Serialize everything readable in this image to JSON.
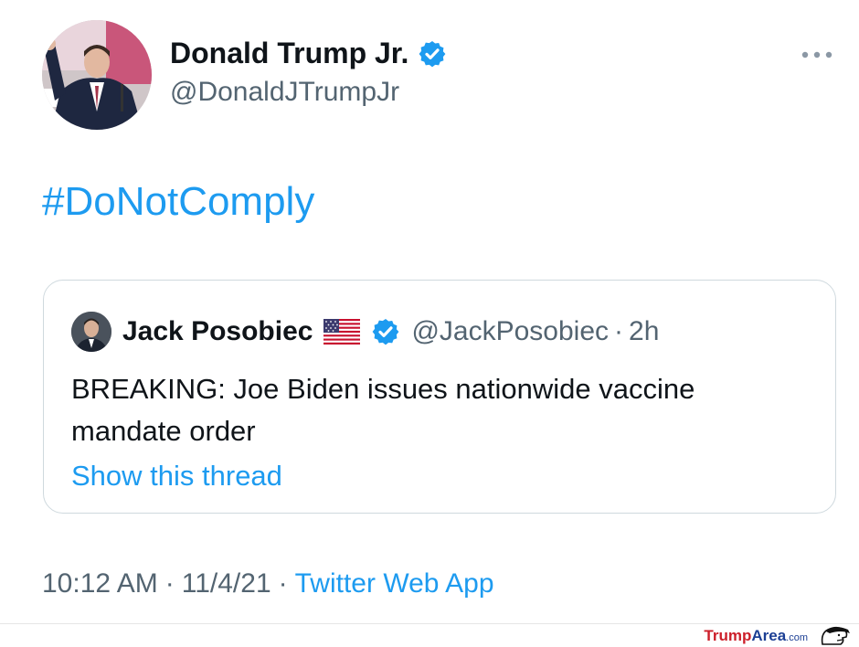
{
  "tweet": {
    "author": {
      "name": "Donald Trump Jr.",
      "handle": "@DonaldJTrumpJr",
      "verified": true
    },
    "text": "#DoNotComply",
    "quoted_tweet": {
      "author_name": "Jack Posobiec",
      "author_handle": "@JackPosobiec",
      "separator": "·",
      "time": "2h",
      "text": "BREAKING: Joe Biden issues nationwide vaccine mandate order",
      "show_thread": "Show this thread"
    },
    "meta": {
      "time": "10:12 AM",
      "sep1": "·",
      "date": "11/4/21",
      "sep2": "·",
      "source": "Twitter Web App"
    }
  },
  "watermark": {
    "part1": "Trump",
    "part2": "Area",
    "part3": ".com"
  },
  "colors": {
    "accent": "#1d9bf0",
    "secondary_text": "#536471",
    "primary_text": "#0f1419",
    "border": "#cfd9de",
    "watermark_red": "#cc1f2a",
    "watermark_blue": "#1c3f94"
  },
  "icons": {
    "verified": "verified-badge-icon",
    "more": "more-options-icon",
    "flag": "us-flag-icon",
    "logo": "trumparea-logo-icon"
  }
}
